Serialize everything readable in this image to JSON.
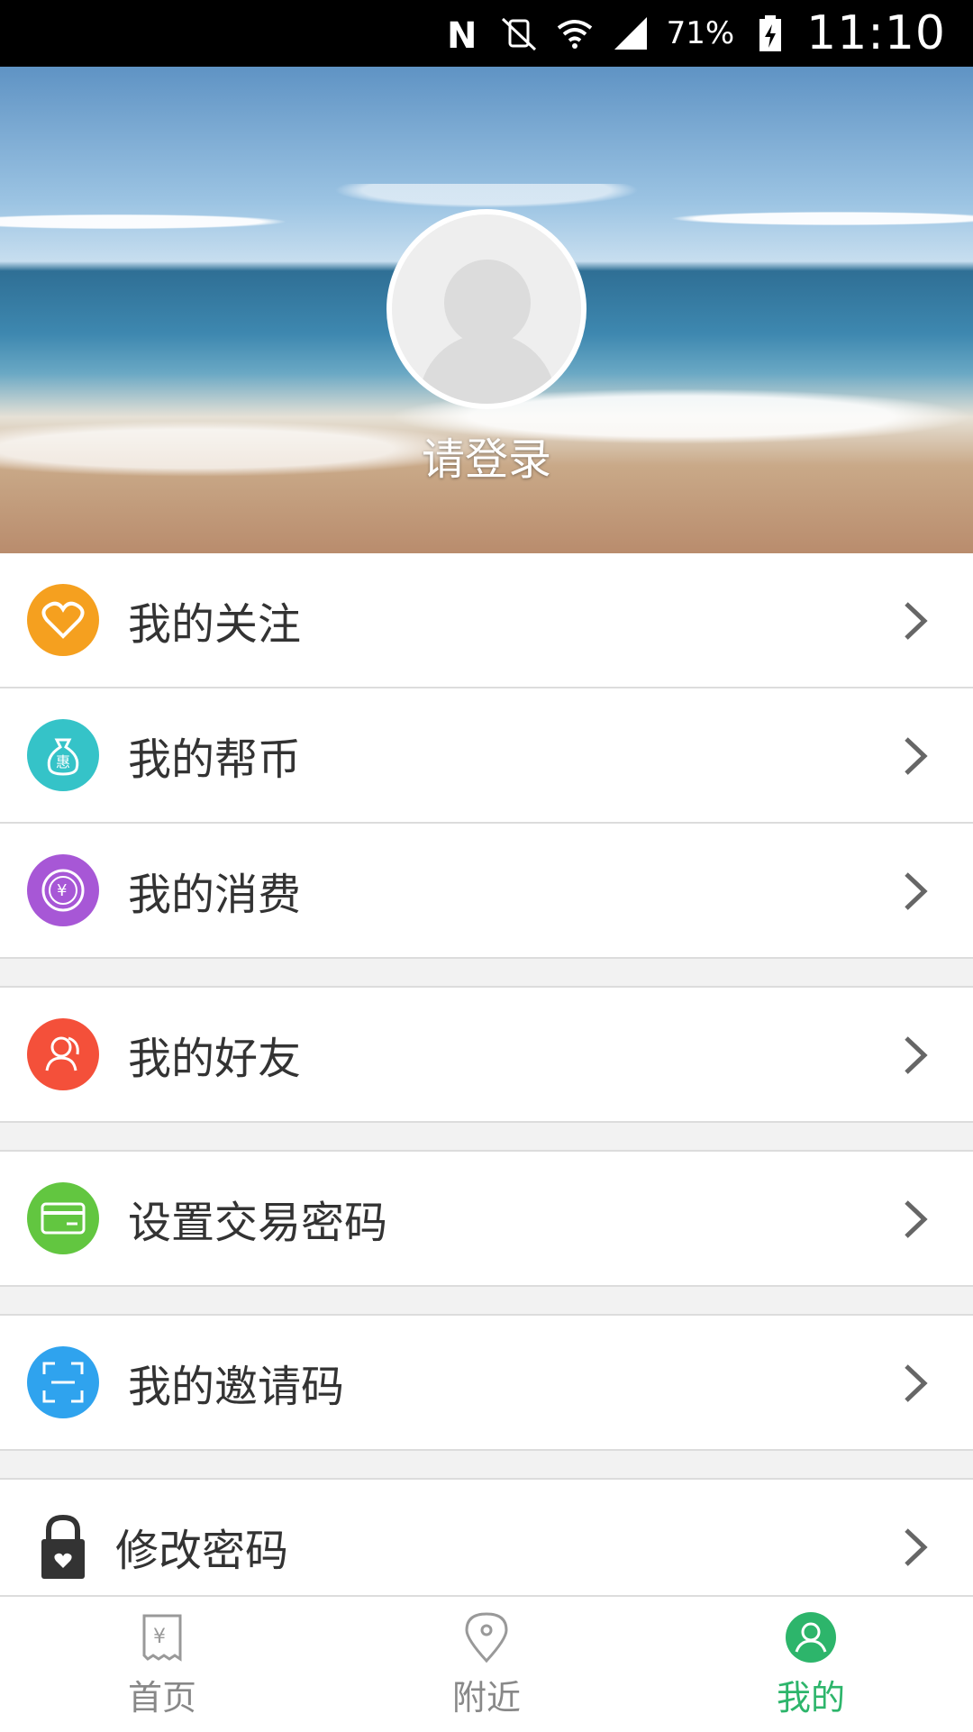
{
  "status_bar": {
    "battery_percent": "71%",
    "time": "11:10"
  },
  "profile": {
    "login_prompt": "请登录"
  },
  "menu": {
    "items": [
      {
        "label": "我的关注",
        "icon": "heart-icon",
        "color": "#f5a01f"
      },
      {
        "label": "我的帮币",
        "icon": "money-bag-icon",
        "color": "#35c3c8"
      },
      {
        "label": "我的消费",
        "icon": "yen-coin-icon",
        "color": "#a757d6"
      },
      {
        "label": "我的好友",
        "icon": "friends-icon",
        "color": "#f4503a"
      },
      {
        "label": "设置交易密码",
        "icon": "card-icon",
        "color": "#62c640"
      },
      {
        "label": "我的邀请码",
        "icon": "scan-code-icon",
        "color": "#2fa3ee"
      },
      {
        "label": "修改密码",
        "icon": "lock-icon",
        "color": "#333333"
      }
    ]
  },
  "bottom_nav": {
    "tabs": [
      {
        "label": "首页",
        "icon": "receipt-yen-icon",
        "active": false
      },
      {
        "label": "附近",
        "icon": "location-pin-icon",
        "active": false
      },
      {
        "label": "我的",
        "icon": "user-icon",
        "active": true
      }
    ],
    "active_color": "#2db56b"
  }
}
